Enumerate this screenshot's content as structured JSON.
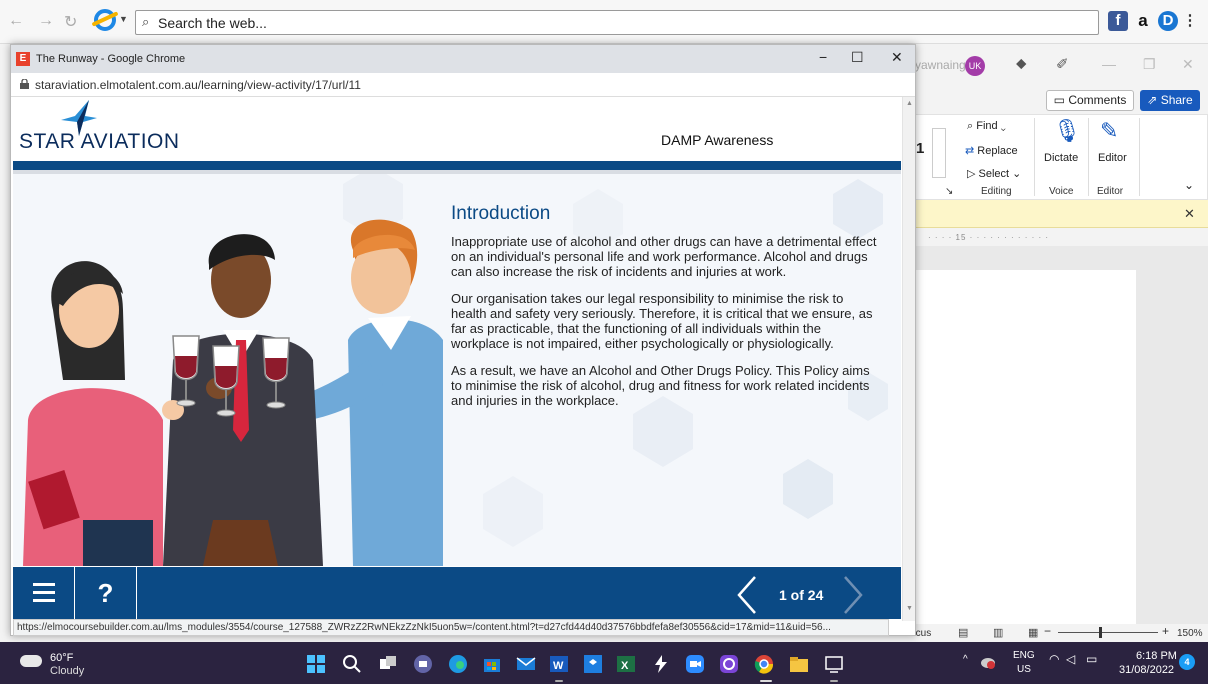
{
  "browser_toolbar": {
    "search_placeholder": "Search the web...",
    "ext_facebook": "f",
    "ext_amazon": "a",
    "ext_d": "D",
    "menu_glyph": "⋮"
  },
  "word": {
    "user_name": "yawnaing",
    "user_initials": "UK",
    "comments_label": "Comments",
    "share_label": "Share",
    "font_size_partial": "1",
    "find_label": "Find",
    "replace_label": "Replace",
    "select_label": "Select",
    "dictate_label": "Dictate",
    "editor_label": "Editor",
    "group_editing": "Editing",
    "group_voice": "Voice",
    "group_editor": "Editor",
    "ruler_mark": "15",
    "focus_label": "Focus",
    "zoom_minus": "−",
    "zoom_plus": "+",
    "zoom_level": "150%"
  },
  "chrome": {
    "window_title": "The Runway - Google Chrome",
    "favicon_letter": "E",
    "url": "staraviation.elmotalent.com.au/learning/view-activity/17/url/11",
    "minimize": "−",
    "maximize": "☐",
    "close": "✕",
    "status_url": "https://elmocoursebuilder.com.au/lms_modules/3554/course_127588_ZWRzZ2RwNEkzZzNkI5uon5w=/content.html?t=d27cfd44d40d37576bbdfefa8ef30556&cid=17&mid=11&uid=56..."
  },
  "course": {
    "logo_text": "STAR AVIATION",
    "title": "DAMP Awareness",
    "intro_heading": "Introduction",
    "paragraphs": [
      "Inappropriate use of alcohol and other drugs can have a detrimental effect on an individual's personal life and work performance. Alcohol and drugs can also increase the risk of incidents and injuries at work.",
      "Our organisation takes our legal responsibility to minimise the risk to health and safety very seriously. Therefore, it is critical that we ensure, as far as practicable, that the functioning of all individuals within the workplace is not impaired, either psychologically or physiologically.",
      "As a result, we have an Alcohol and Other Drugs Policy. This Policy aims to minimise the risk of alcohol, drug and fitness for work related incidents and injuries in the workplace."
    ],
    "help_label": "?",
    "page_counter": "1 of 24",
    "current_page": 1,
    "total_pages": 24
  },
  "taskbar": {
    "temperature": "60°F",
    "condition": "Cloudy",
    "lang_line1": "ENG",
    "lang_line2": "US",
    "time": "6:18 PM",
    "date": "31/08/2022",
    "notification_count": "4"
  },
  "colors": {
    "course_blue": "#0b4a85",
    "share_blue": "#185abd",
    "elmo_red": "#e8412c",
    "taskbar": "#2b2340"
  }
}
